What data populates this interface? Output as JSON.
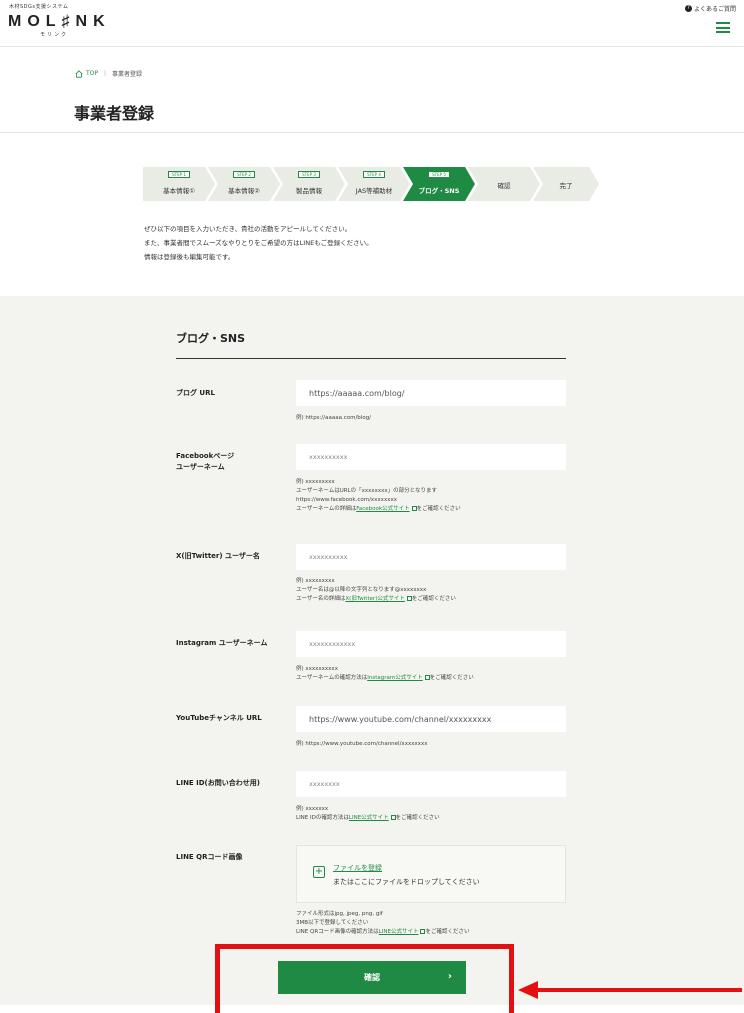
{
  "header": {
    "logo_sub": "木材SDGs支援システム",
    "logo": "MOL♯NK",
    "logo_kana": "モリンク",
    "help_label": "よくあるご質問",
    "help_icon": "question-icon",
    "menu_icon": "hamburger-menu-icon"
  },
  "breadcrumb": {
    "home": "TOP",
    "current": "事業者登録"
  },
  "page_title": "事業者登録",
  "steps": [
    {
      "num": "STEP 1",
      "label": "基本情報①"
    },
    {
      "num": "STEP 2",
      "label": "基本情報②"
    },
    {
      "num": "STEP 3",
      "label": "製品情報"
    },
    {
      "num": "STEP 4",
      "label": "JAS等補助材"
    },
    {
      "num": "STEP 5",
      "label": "ブログ・SNS"
    },
    {
      "num": "",
      "label": "確認"
    },
    {
      "num": "",
      "label": "完了"
    }
  ],
  "intro": [
    "ぜひ以下の項目を入力いただき、貴社の活動をアピールしてください。",
    "また、事業者間でスムーズなやりとりをご希望の方はLINEもご登録ください。",
    "情報は登録後も編集可能です。"
  ],
  "section_title": "ブログ・SNS",
  "fields": {
    "blog": {
      "label": "ブログ URL",
      "value": "https://aaaaa.com/blog/",
      "help": "例) https://aaaaa.com/blog/"
    },
    "facebook": {
      "label_1": "Facebookページ",
      "label_2": "ユーザーネーム",
      "value": "xxxxxxxxxx",
      "help_1": "例) xxxxxxxxx",
      "help_2": "ユーザーネームはURLの「xxxxxxxx」の部分となります",
      "help_3": "https://www.facebook.com/xxxxxxxx",
      "help_4_pre": "ユーザーネームの詳細は",
      "help_4_link": "Facebook公式サイト",
      "help_4_post": "をご確認ください"
    },
    "twitter": {
      "label": "X(旧Twitter) ユーザー名",
      "value": "xxxxxxxxxx",
      "help_1": "例) xxxxxxxxx",
      "help_2": "ユーザー名は@以降の文字列となります@xxxxxxxx",
      "help_3_pre": "ユーザー名の詳細は",
      "help_3_link": "X(旧Twitter)公式サイト",
      "help_3_post": "をご確認ください"
    },
    "instagram": {
      "label": "Instagram ユーザーネーム",
      "value": "xxxxxxxxxxxx",
      "help_1": "例) xxxxxxxxxx",
      "help_2_pre": "ユーザーネームの確認方法は",
      "help_2_link": "Instagram公式サイト",
      "help_2_post": "をご確認ください"
    },
    "youtube": {
      "label": "YouTubeチャンネル URL",
      "value": "https://www.youtube.com/channel/xxxxxxxxx",
      "help": "例) https://www.youtube.com/channel/xxxxxxxx"
    },
    "line": {
      "label": "LINE ID(お問い合わせ用)",
      "value": "xxxxxxxx",
      "help_1": "例) xxxxxxx",
      "help_2_pre": "LINE IDの確認方法は",
      "help_2_link": "LINE公式サイト",
      "help_2_post": "をご確認ください"
    },
    "line_qr": {
      "label": "LINE QRコード画像",
      "upload_link": "ファイルを登録",
      "upload_text": "またはここにファイルをドロップしてください",
      "help_1": "ファイル形式はjpg, jpeg, png, gif",
      "help_2": "3MB以下で登録してください",
      "help_3_pre": "LINE QRコード画像の確認方法は",
      "help_3_link": "LINE公式サイト",
      "help_3_post": "をご確認ください"
    }
  },
  "confirm_button": "確認",
  "colors": {
    "accent": "#1e8a43",
    "highlight": "#e21010",
    "section_bg": "#f3f4ef"
  }
}
